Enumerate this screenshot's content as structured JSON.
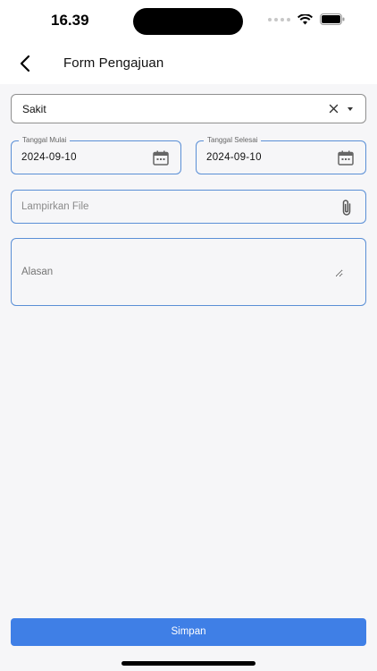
{
  "status_bar": {
    "time": "16.39"
  },
  "header": {
    "title": "Form Pengajuan"
  },
  "form": {
    "type_select": {
      "value": "Sakit"
    },
    "start_date": {
      "label": "Tanggal Mulai",
      "value": "2024-09-10"
    },
    "end_date": {
      "label": "Tanggal Selesai",
      "value": "2024-09-10"
    },
    "attachment": {
      "placeholder": "Lampirkan File"
    },
    "reason": {
      "placeholder": "Alasan"
    },
    "submit_label": "Simpan"
  },
  "colors": {
    "accent": "#3f7fe6",
    "field_border_active": "#5a8fd6",
    "background": "#f6f6f8"
  }
}
